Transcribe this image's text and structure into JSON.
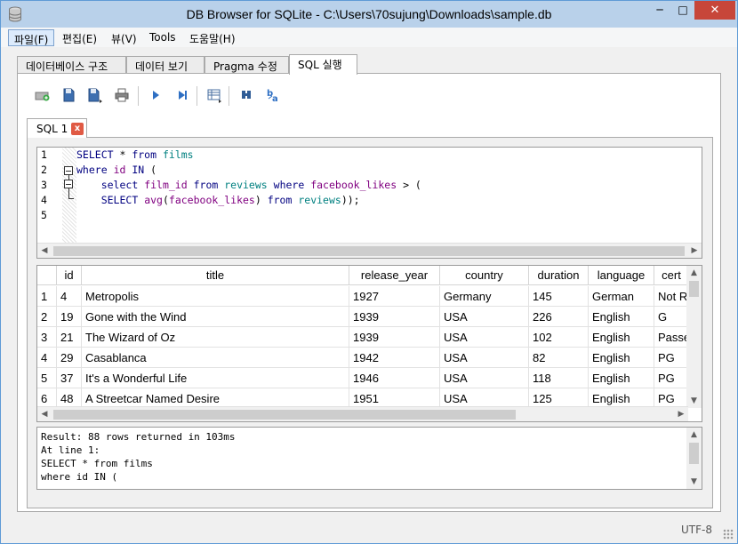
{
  "window": {
    "title": "DB Browser for SQLite - C:\\Users\\70sujung\\Downloads\\sample.db",
    "minimize": "─",
    "maximize": "□",
    "close": "✕"
  },
  "menu": [
    {
      "label": "파일(F)"
    },
    {
      "label": "편집(E)"
    },
    {
      "label": "뷰(V)"
    },
    {
      "label": "Tools"
    },
    {
      "label": "도움말(H)"
    }
  ],
  "tabs": [
    {
      "label": "데이터베이스 구조"
    },
    {
      "label": "데이터 보기"
    },
    {
      "label": "Pragma 수정"
    },
    {
      "label": "SQL 실행"
    }
  ],
  "toolbar_icons": [
    "open-tab-icon",
    "open-sql-icon",
    "save-sql-icon",
    "print-icon",
    "execute-all-icon",
    "execute-current-icon",
    "save-results-icon",
    "find-icon",
    "find-replace-icon"
  ],
  "sql_tab": {
    "label": "SQL 1",
    "close": "x"
  },
  "editor": {
    "line_numbers": [
      "1",
      "2",
      "3",
      "4",
      "5"
    ]
  },
  "grid": {
    "columns": [
      "id",
      "title",
      "release_year",
      "country",
      "duration",
      "language",
      "cert"
    ],
    "rows": [
      {
        "n": "1",
        "cells": [
          "4",
          "Metropolis",
          "1927",
          "Germany",
          "145",
          "German",
          "Not R"
        ]
      },
      {
        "n": "2",
        "cells": [
          "19",
          "Gone with the Wind",
          "1939",
          "USA",
          "226",
          "English",
          "G"
        ]
      },
      {
        "n": "3",
        "cells": [
          "21",
          "The Wizard of Oz",
          "1939",
          "USA",
          "102",
          "English",
          "Passe"
        ]
      },
      {
        "n": "4",
        "cells": [
          "29",
          "Casablanca",
          "1942",
          "USA",
          "82",
          "English",
          "PG"
        ]
      },
      {
        "n": "5",
        "cells": [
          "37",
          "It's a Wonderful Life",
          "1946",
          "USA",
          "118",
          "English",
          "PG"
        ]
      },
      {
        "n": "6",
        "cells": [
          "48",
          "A Streetcar Named Desire",
          "1951",
          "USA",
          "125",
          "English",
          "PG"
        ]
      }
    ]
  },
  "log": [
    "Result: 88 rows returned in 103ms",
    "At line 1:",
    "SELECT * from films",
    "where id IN ("
  ],
  "status": {
    "encoding": "UTF-8"
  },
  "colors": {
    "title_bar": "#b9d1ea",
    "close_button": "#c7463a",
    "keyword": "#000080",
    "table": "#008080",
    "column": "#800080"
  }
}
